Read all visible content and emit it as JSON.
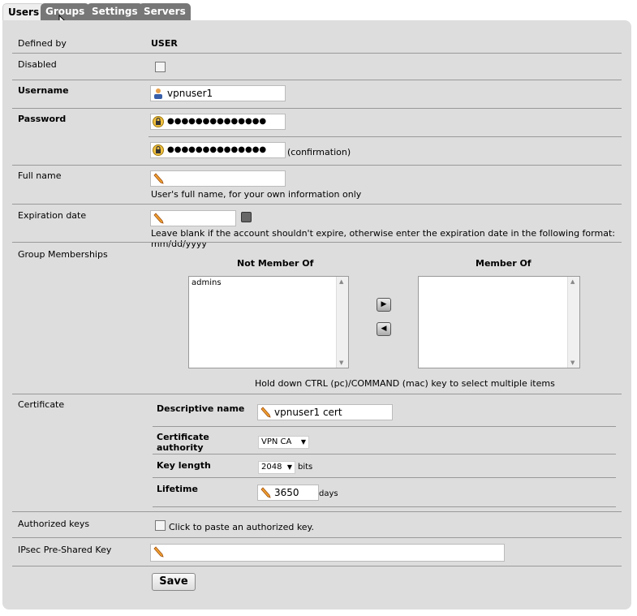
{
  "tabs": [
    {
      "label": "Users"
    },
    {
      "label": "Groups"
    },
    {
      "label": "Settings"
    },
    {
      "label": "Servers"
    }
  ],
  "form": {
    "defined_by": {
      "label": "Defined by",
      "value": "USER"
    },
    "disabled": {
      "label": "Disabled"
    },
    "username": {
      "label": "Username",
      "value": "vpnuser1"
    },
    "password": {
      "label": "Password",
      "value": "●●●●●●●●●●●●●●",
      "confirm_value": "●●●●●●●●●●●●●●",
      "confirmation_note": "(confirmation)"
    },
    "full_name": {
      "label": "Full name",
      "value": "",
      "hint": "User's full name, for your own information only"
    },
    "expiration": {
      "label": "Expiration date",
      "value": "",
      "hint": "Leave blank if the account shouldn't expire, otherwise enter the expiration date in the following format: mm/dd/yyyy"
    },
    "groups": {
      "label": "Group Memberships",
      "not_member_header": "Not Member Of",
      "member_header": "Member Of",
      "not_member_items": [
        "admins"
      ],
      "member_items": [],
      "move_right": "▶",
      "move_left": "◀",
      "hint": "Hold down CTRL (pc)/COMMAND (mac) key to select multiple items"
    },
    "certificate": {
      "label": "Certificate",
      "descriptive_name_label": "Descriptive name",
      "descriptive_name_value": "vpnuser1 cert",
      "ca_label_line1": "Certificate",
      "ca_label_line2": "authority",
      "ca_value": "VPN CA",
      "key_length_label": "Key length",
      "key_length_value": "2048",
      "key_length_unit": "bits",
      "lifetime_label": "Lifetime",
      "lifetime_value": "3650",
      "lifetime_unit": "days"
    },
    "authorized_keys": {
      "label": "Authorized keys",
      "checkbox_text": "Click to paste an authorized key."
    },
    "ipsec_psk": {
      "label": "IPsec Pre-Shared Key",
      "value": ""
    },
    "save_label": "Save"
  },
  "colors": {
    "panel": "#dddddd",
    "tab_inactive": "#777777",
    "tab_active": "#eeeeee"
  }
}
